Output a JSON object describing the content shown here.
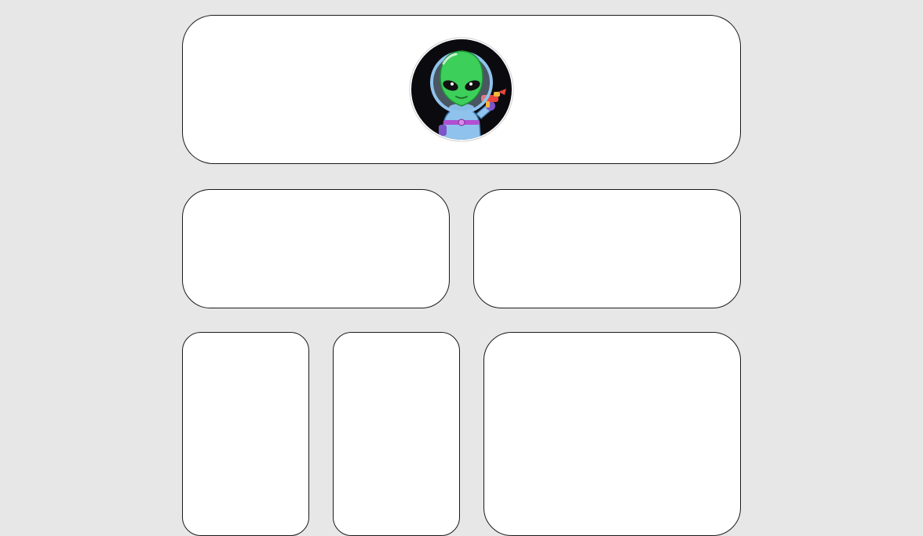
{
  "header": {
    "avatar_icon": "alien-astronaut-avatar"
  },
  "colors": {
    "page_background": "#e7e7e7",
    "card_background": "#ffffff",
    "card_border": "#1a1a1a",
    "avatar_background": "#0b0b0f",
    "alien_skin": "#3ccf5a",
    "suit": "#8fc3ee"
  }
}
